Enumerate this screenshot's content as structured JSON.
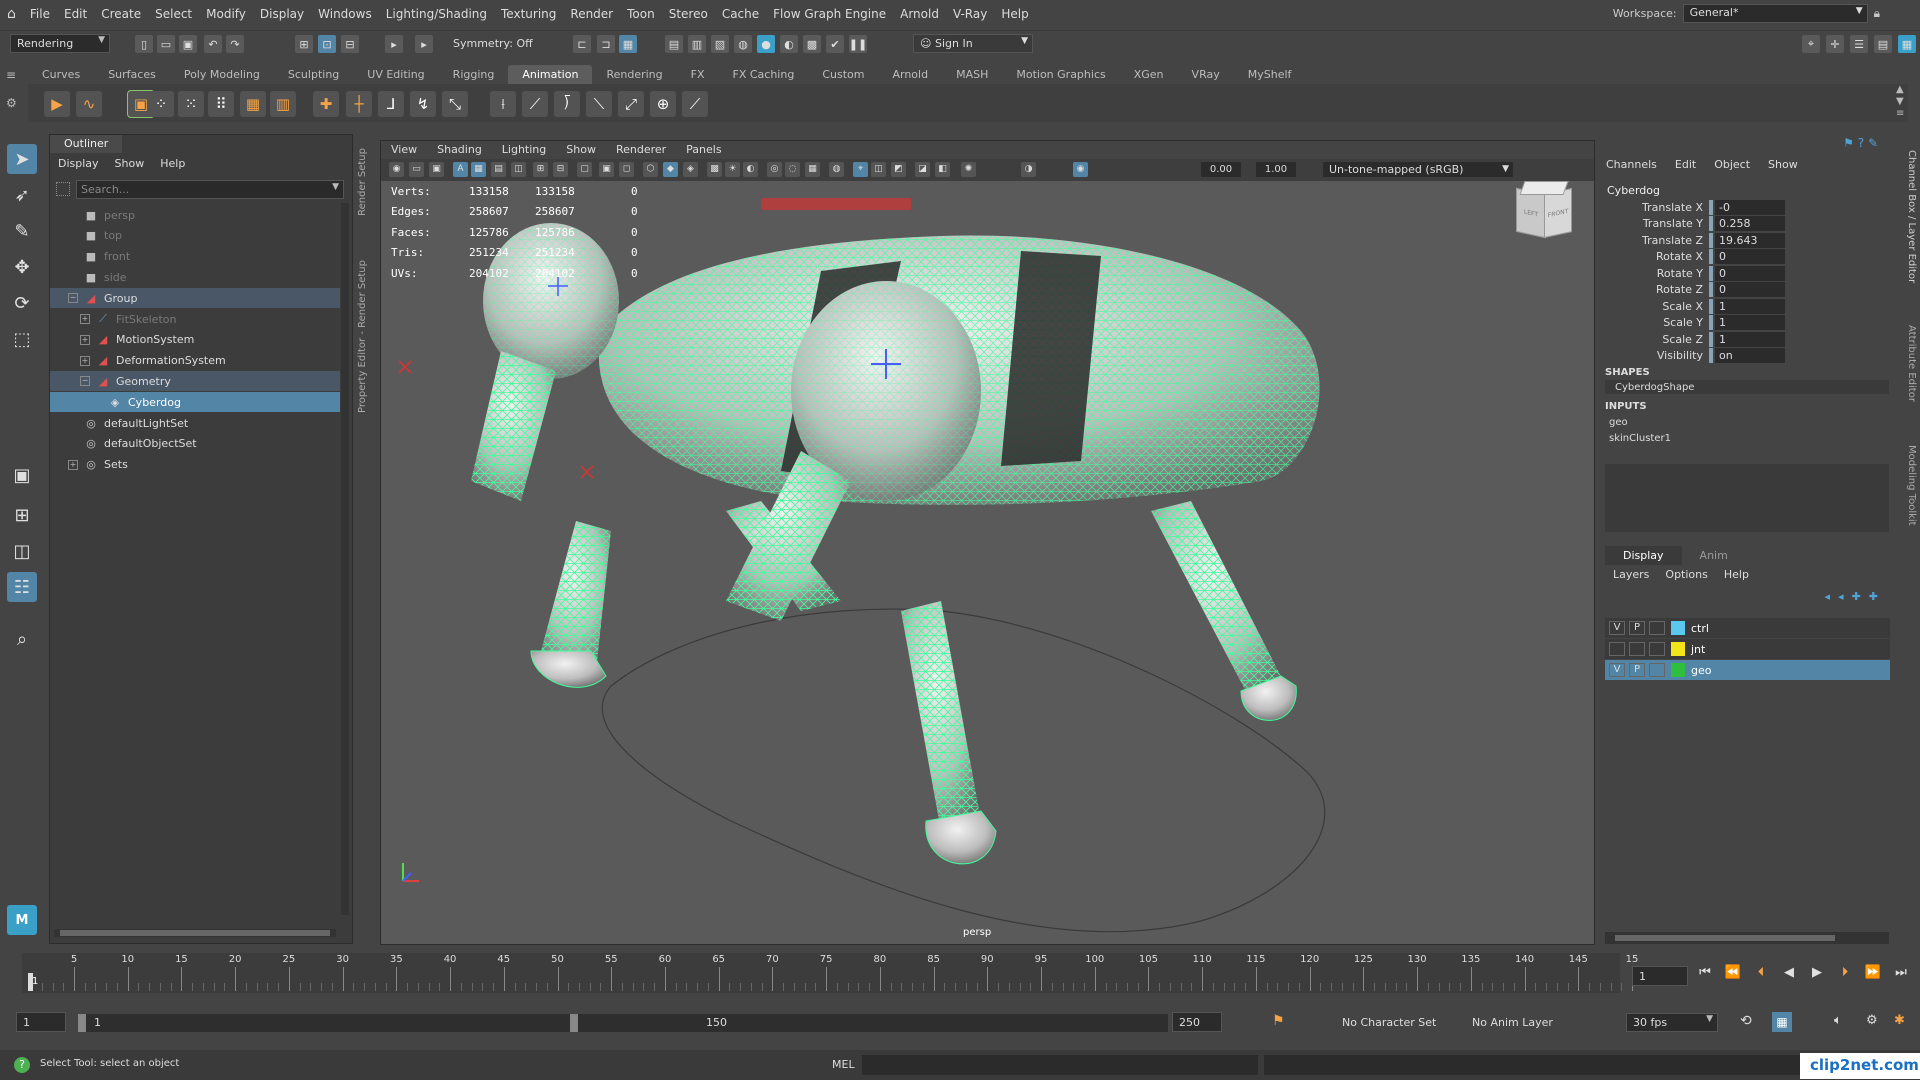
{
  "menubar": {
    "items": [
      "File",
      "Edit",
      "Create",
      "Select",
      "Modify",
      "Display",
      "Windows",
      "Lighting/Shading",
      "Texturing",
      "Render",
      "Toon",
      "Stereo",
      "Cache",
      "Flow Graph Engine",
      "Arnold",
      "V-Ray",
      "Help"
    ],
    "workspace_label": "Workspace:",
    "workspace_value": "General*"
  },
  "statusline": {
    "mode": "Rendering",
    "symmetry": "Symmetry: Off",
    "sign_in": "Sign In"
  },
  "shelf": {
    "tabs": [
      "Curves",
      "Surfaces",
      "Poly Modeling",
      "Sculpting",
      "UV Editing",
      "Rigging",
      "Animation",
      "Rendering",
      "FX",
      "FX Caching",
      "Custom",
      "Arnold",
      "MASH",
      "Motion Graphics",
      "XGen",
      "VRay",
      "MyShelf"
    ],
    "active": "Animation"
  },
  "outliner": {
    "title": "Outliner",
    "menu": [
      "Display",
      "Show",
      "Help"
    ],
    "search_placeholder": "Search...",
    "rows": [
      {
        "label": "persp",
        "icon": "camera-icon",
        "indent": 0,
        "exp": "",
        "state": "dim"
      },
      {
        "label": "top",
        "icon": "camera-icon",
        "indent": 0,
        "exp": "",
        "state": "dim"
      },
      {
        "label": "front",
        "icon": "camera-icon",
        "indent": 0,
        "exp": "",
        "state": "dim"
      },
      {
        "label": "side",
        "icon": "camera-icon",
        "indent": 0,
        "exp": "",
        "state": "dim"
      },
      {
        "label": "Group",
        "icon": "transform-icon",
        "indent": 0,
        "exp": "−",
        "state": "hl"
      },
      {
        "label": "FitSkeleton",
        "icon": "joint-icon",
        "indent": 1,
        "exp": "+",
        "state": "dim"
      },
      {
        "label": "MotionSystem",
        "icon": "transform-icon",
        "indent": 1,
        "exp": "+",
        "state": ""
      },
      {
        "label": "DeformationSystem",
        "icon": "transform-icon",
        "indent": 1,
        "exp": "+",
        "state": ""
      },
      {
        "label": "Geometry",
        "icon": "transform-icon",
        "indent": 1,
        "exp": "−",
        "state": "hl"
      },
      {
        "label": "Cyberdog",
        "icon": "mesh-icon",
        "indent": 2,
        "exp": "",
        "state": "sel"
      },
      {
        "label": "defaultLightSet",
        "icon": "set-icon",
        "indent": 0,
        "exp": "",
        "state": ""
      },
      {
        "label": "defaultObjectSet",
        "icon": "set-icon",
        "indent": 0,
        "exp": "",
        "state": ""
      },
      {
        "label": "Sets",
        "icon": "set-icon",
        "indent": 0,
        "exp": "+",
        "state": ""
      }
    ]
  },
  "side_tabs": [
    "Render Setup",
    "Property Editor - Render Setup"
  ],
  "viewport": {
    "menu": [
      "View",
      "Shading",
      "Lighting",
      "Show",
      "Renderer",
      "Panels"
    ],
    "exposure": "0.00",
    "gamma": "1.00",
    "colorspace": "Un-tone-mapped (sRGB)",
    "camera_label": "persp",
    "cube_left": "LEFT",
    "cube_front": "FRONT",
    "hud": [
      {
        "label": "Verts:",
        "a": "133158",
        "b": "133158",
        "c": "0"
      },
      {
        "label": "Edges:",
        "a": "258607",
        "b": "258607",
        "c": "0"
      },
      {
        "label": "Faces:",
        "a": "125786",
        "b": "125786",
        "c": "0"
      },
      {
        "label": "Tris:",
        "a": "251234",
        "b": "251234",
        "c": "0"
      },
      {
        "label": "UVs:",
        "a": "204102",
        "b": "204102",
        "c": "0"
      }
    ]
  },
  "channelbox": {
    "menu": [
      "Channels",
      "Edit",
      "Object",
      "Show"
    ],
    "object": "Cyberdog",
    "attrs": [
      {
        "label": "Translate X",
        "value": "-0"
      },
      {
        "label": "Translate Y",
        "value": "0.258"
      },
      {
        "label": "Translate Z",
        "value": "19.643"
      },
      {
        "label": "Rotate X",
        "value": "0"
      },
      {
        "label": "Rotate Y",
        "value": "0"
      },
      {
        "label": "Rotate Z",
        "value": "0"
      },
      {
        "label": "Scale X",
        "value": "1"
      },
      {
        "label": "Scale Y",
        "value": "1"
      },
      {
        "label": "Scale Z",
        "value": "1"
      },
      {
        "label": "Visibility",
        "value": "on"
      }
    ],
    "shapes_head": "SHAPES",
    "shape": "CyberdogShape",
    "inputs_head": "INPUTS",
    "inputs": [
      "geo",
      "skinCluster1"
    ],
    "side_tabs": [
      "Channel Box / Layer Editor",
      "Attribute Editor",
      "Modeling Toolkit"
    ]
  },
  "layers": {
    "tabs": [
      "Display",
      "Anim"
    ],
    "menu": [
      "Layers",
      "Options",
      "Help"
    ],
    "rows": [
      {
        "v": "V",
        "p": "P",
        "name": "ctrl",
        "color": "#5bc8f0",
        "sel": false
      },
      {
        "v": "",
        "p": "",
        "name": "jnt",
        "color": "#f2e51c",
        "sel": false
      },
      {
        "v": "V",
        "p": "P",
        "name": "geo",
        "color": "#2fbf3f",
        "sel": true
      }
    ]
  },
  "timeline": {
    "ticks": [
      "5",
      "10",
      "15",
      "20",
      "25",
      "30",
      "35",
      "40",
      "45",
      "50",
      "55",
      "60",
      "65",
      "70",
      "75",
      "80",
      "85",
      "90",
      "95",
      "100",
      "105",
      "110",
      "115",
      "120",
      "125",
      "130",
      "135",
      "140",
      "145",
      "15"
    ],
    "first_tick": "1",
    "current_frame": "1"
  },
  "range": {
    "start": "1",
    "inner_start": "1",
    "inner_end": "150",
    "end": "250",
    "character_set": "No Character Set",
    "anim_layer": "No Anim Layer",
    "fps": "30 fps"
  },
  "status": {
    "message": "Select Tool: select an object",
    "mel_label": "MEL",
    "watermark": "clip2net.com"
  },
  "colors": {
    "accent": "#5285a6",
    "wireframe": "#3dff9a",
    "shelf_orange": "#f5a346"
  }
}
